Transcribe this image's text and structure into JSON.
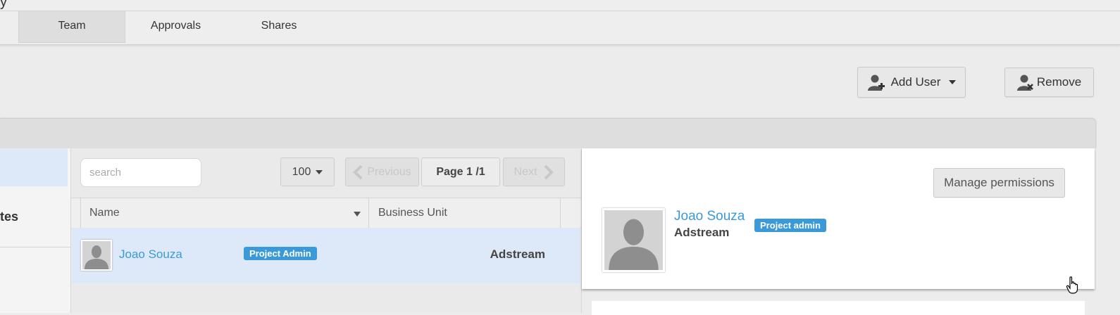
{
  "top": {
    "glyph": "y"
  },
  "tabs": [
    {
      "label": "Team",
      "active": true
    },
    {
      "label": "Approvals",
      "active": false
    },
    {
      "label": "Shares",
      "active": false
    }
  ],
  "toolbar": {
    "add_user_label": "Add User",
    "remove_label": "Remove"
  },
  "left_nav": {
    "partial_label": "tes"
  },
  "list": {
    "search_placeholder": "search",
    "page_size": "100",
    "previous_label": "Previous",
    "page_label": "Page 1 /1",
    "next_label": "Next",
    "columns": [
      "Name",
      "Business Unit"
    ],
    "rows": [
      {
        "name": "Joao Souza",
        "role": "Project Admin",
        "business_unit": "Adstream"
      }
    ]
  },
  "detail": {
    "manage_label": "Manage permissions",
    "name": "Joao Souza",
    "company": "Adstream",
    "role": "Project admin"
  },
  "colors": {
    "accent": "#3a9ad9",
    "selected_row": "#dde9f9"
  }
}
